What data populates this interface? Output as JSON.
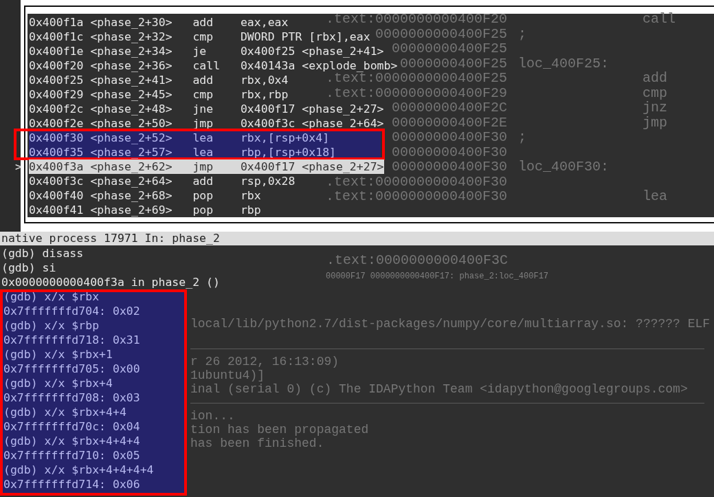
{
  "disassembly": {
    "pointer": ">",
    "rows": [
      {
        "address": "0x400f1a",
        "symbol": "<phase_2+30>",
        "mnemonic": "add",
        "operands": "eax,eax",
        "selected": false,
        "current": false
      },
      {
        "address": "0x400f1c",
        "symbol": "<phase_2+32>",
        "mnemonic": "cmp",
        "operands": "DWORD PTR [rbx],eax",
        "selected": false,
        "current": false
      },
      {
        "address": "0x400f1e",
        "symbol": "<phase_2+34>",
        "mnemonic": "je",
        "operands": "0x400f25 <phase_2+41>",
        "selected": false,
        "current": false
      },
      {
        "address": "0x400f20",
        "symbol": "<phase_2+36>",
        "mnemonic": "call",
        "operands": "0x40143a <explode_bomb>",
        "selected": false,
        "current": false
      },
      {
        "address": "0x400f25",
        "symbol": "<phase_2+41>",
        "mnemonic": "add",
        "operands": "rbx,0x4",
        "selected": false,
        "current": false
      },
      {
        "address": "0x400f29",
        "symbol": "<phase_2+45>",
        "mnemonic": "cmp",
        "operands": "rbx,rbp",
        "selected": false,
        "current": false
      },
      {
        "address": "0x400f2c",
        "symbol": "<phase_2+48>",
        "mnemonic": "jne",
        "operands": "0x400f17 <phase_2+27>",
        "selected": false,
        "current": false
      },
      {
        "address": "0x400f2e",
        "symbol": "<phase_2+50>",
        "mnemonic": "jmp",
        "operands": "0x400f3c <phase_2+64>",
        "selected": false,
        "current": false
      },
      {
        "address": "0x400f30",
        "symbol": "<phase_2+52>",
        "mnemonic": "lea",
        "operands": "rbx,[rsp+0x4]",
        "selected": true,
        "current": false
      },
      {
        "address": "0x400f35",
        "symbol": "<phase_2+57>",
        "mnemonic": "lea",
        "operands": "rbp,[rsp+0x18]",
        "selected": true,
        "current": false
      },
      {
        "address": "0x400f3a",
        "symbol": "<phase_2+62>",
        "mnemonic": "jmp",
        "operands": "0x400f17 <phase_2+27>",
        "selected": false,
        "current": true
      },
      {
        "address": "0x400f3c",
        "symbol": "<phase_2+64>",
        "mnemonic": "add",
        "operands": "rsp,0x28",
        "selected": false,
        "current": false
      },
      {
        "address": "0x400f40",
        "symbol": "<phase_2+68>",
        "mnemonic": "pop",
        "operands": "rbx",
        "selected": false,
        "current": false
      },
      {
        "address": "0x400f41",
        "symbol": "<phase_2+69>",
        "mnemonic": "pop",
        "operands": "rbp",
        "selected": false,
        "current": false
      }
    ]
  },
  "status_bar": {
    "text": "native process 17971 In: phase_2"
  },
  "console": {
    "lines": [
      {
        "text": "(gdb) disass",
        "selected": false
      },
      {
        "text": "(gdb) si",
        "selected": false
      },
      {
        "text": "0x0000000000400f3a in phase_2 ()",
        "selected": false
      },
      {
        "text": "(gdb) x/x $rbx",
        "selected": true
      },
      {
        "text": "0x7fffffffd704: 0x02",
        "selected": true
      },
      {
        "text": "(gdb) x/x $rbp",
        "selected": true
      },
      {
        "text": "0x7fffffffd718: 0x31",
        "selected": true
      },
      {
        "text": "(gdb) x/x $rbx+1",
        "selected": true
      },
      {
        "text": "0x7fffffffd705: 0x00",
        "selected": true
      },
      {
        "text": "(gdb) x/x $rbx+4",
        "selected": true
      },
      {
        "text": "0x7fffffffd708: 0x03",
        "selected": true
      },
      {
        "text": "(gdb) x/x $rbx+4+4",
        "selected": true
      },
      {
        "text": "0x7fffffffd70c: 0x04",
        "selected": true
      },
      {
        "text": "(gdb) x/x $rbx+4+4+4",
        "selected": true
      },
      {
        "text": "0x7fffffffd710: 0x05",
        "selected": true
      },
      {
        "text": "(gdb) x/x $rbx+4+4+4+4",
        "selected": true
      },
      {
        "text": "0x7fffffffd714: 0x06",
        "selected": true
      }
    ]
  },
  "background_window": {
    "listing": [
      {
        "address": ".text:0000000000400F20",
        "mnemonic": "call"
      },
      {
        "address": "0000000000400F25",
        "label": ";"
      },
      {
        "address": "00000000400F25"
      },
      {
        "address": "0000000400F25",
        "label": "loc_400F25:"
      },
      {
        "address": ".text:0000000000400F25",
        "mnemonic": "add"
      },
      {
        "address": ".text:0000000000400F29",
        "mnemonic": "cmp"
      },
      {
        "address": "00000000400F2C",
        "mnemonic": "jnz"
      },
      {
        "address": "00000000400F2E",
        "mnemonic": "jmp"
      },
      {
        "address": "00000000400F30",
        "label": ";"
      },
      {
        "address": "00000000400F30"
      },
      {
        "address": "00000000400F30",
        "label": "loc_400F30:"
      },
      {
        "address": ".text:0000000000400F30"
      },
      {
        "address": ".text:0000000000400F30",
        "mnemonic": "lea"
      }
    ],
    "position": ".text:0000000000400F3C",
    "location": "00000F17 0000000000400F17: phase_2:loc_400F17",
    "output": [
      {
        "kind": "text",
        "text": "local/lib/python2.7/dist-packages/numpy/core/multiarray.so: ?????? ELF"
      },
      {
        "kind": "rule"
      },
      {
        "kind": "text",
        "text": "r 26 2012, 16:13:09)"
      },
      {
        "kind": "text",
        "text": "1ubuntu4)]"
      },
      {
        "kind": "text",
        "text": "inal (serial 0) (c) The IDAPython Team <idapython@googlegroups.com>"
      },
      {
        "kind": "rule"
      },
      {
        "kind": "text",
        "text": "ion..."
      },
      {
        "kind": "text",
        "text": "tion has been propagated"
      },
      {
        "kind": "text",
        "text": "has been finished."
      }
    ]
  }
}
